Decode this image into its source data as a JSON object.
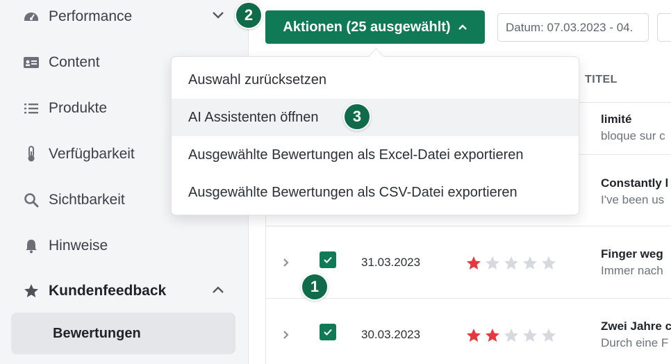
{
  "sidebar": {
    "items": [
      {
        "label": "Performance",
        "icon": "gauge-icon"
      },
      {
        "label": "Content",
        "icon": "id-card-icon"
      },
      {
        "label": "Produkte",
        "icon": "list-icon"
      },
      {
        "label": "Verfügbarkeit",
        "icon": "thermometer-icon"
      },
      {
        "label": "Sichtbarkeit",
        "icon": "search-icon"
      },
      {
        "label": "Hinweise",
        "icon": "bell-icon"
      },
      {
        "label": "Kundenfeedback",
        "icon": "star-icon"
      }
    ],
    "sub_item": "Bewertungen"
  },
  "toolbar": {
    "actions_label": "Aktionen (25 ausgewählt)",
    "date_value": "Datum: 07.03.2023 - 04."
  },
  "menu": {
    "items": [
      "Auswahl zurücksetzen",
      "AI Assistenten öffnen",
      "Ausgewählte Bewertungen als Excel-Datei exportieren",
      "Ausgewählte Bewertungen als CSV-Datei exportieren"
    ]
  },
  "table": {
    "column_title": "TITEL",
    "rows": [
      {
        "title": "limité",
        "subtitle": "bloque sur c"
      },
      {
        "title": "Constantly l",
        "subtitle": "I've been us"
      },
      {
        "date": "31.03.2023",
        "rating": 1,
        "title": "Finger weg",
        "subtitle": "Immer nach"
      },
      {
        "date": "30.03.2023",
        "rating": 2,
        "title": "Zwei Jahre c",
        "subtitle": "Durch eine F"
      }
    ]
  },
  "markers": [
    "1",
    "2",
    "3"
  ],
  "colors": {
    "accent": "#0f7a55",
    "star_filled": "#e53940",
    "star_empty": "#d6d9dd"
  }
}
